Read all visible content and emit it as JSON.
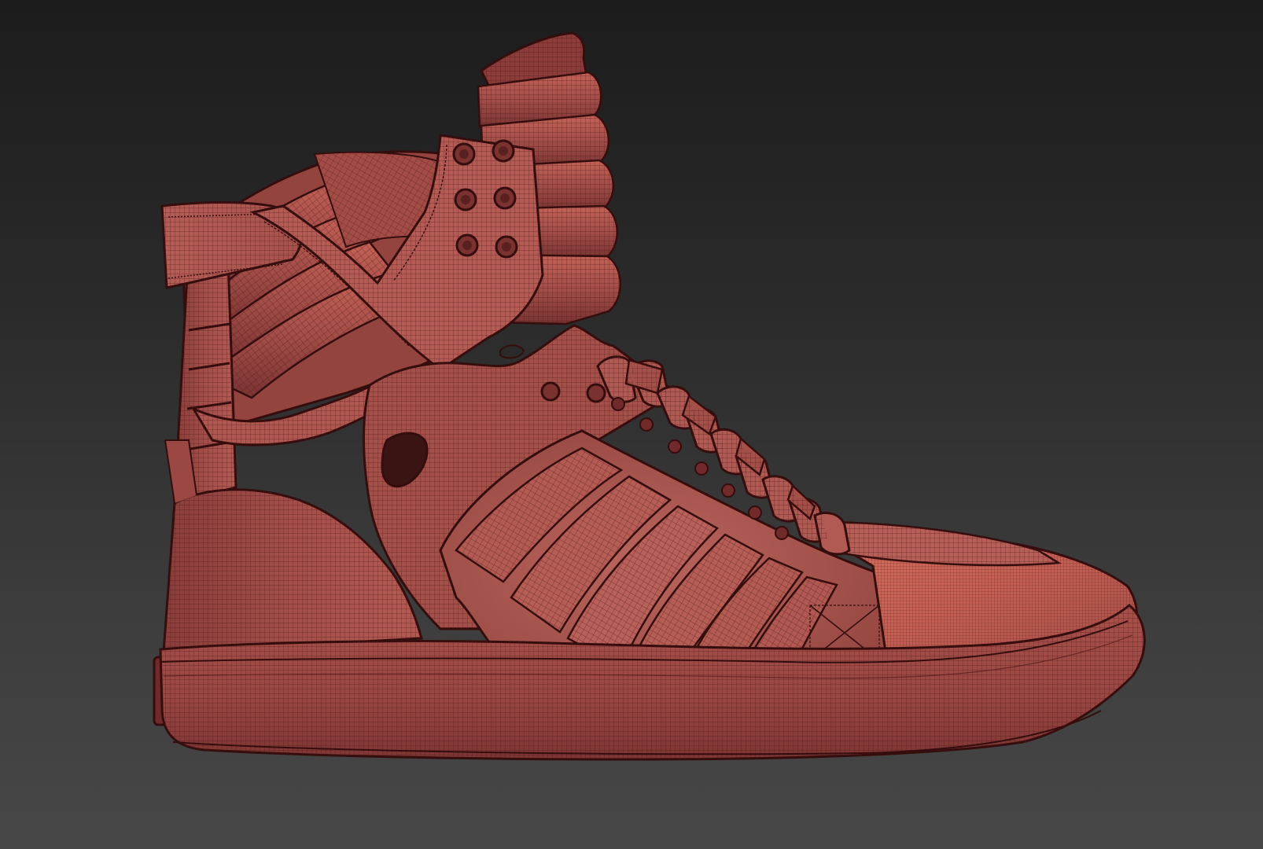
{
  "viewport": {
    "background_top": "#1c1c1c",
    "background_bottom": "#474747",
    "shading_mode": "wireframe-over-shaded"
  },
  "model": {
    "subject": "high-top-sneaker",
    "view": "side-lateral",
    "base_color": "#b8554e",
    "mid_color": "#9c4541",
    "dark_color": "#6f2a29",
    "highlight_color": "#d76c5c",
    "wire_color": "#4a1616",
    "outline_color": "#350d0d"
  }
}
